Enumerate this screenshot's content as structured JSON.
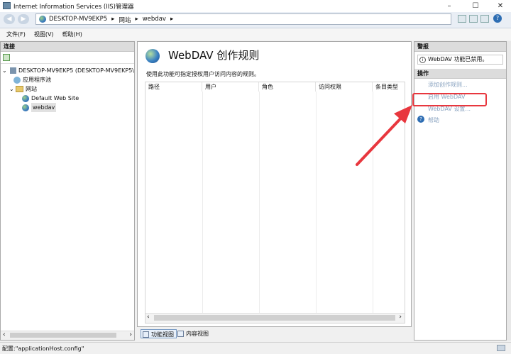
{
  "window": {
    "title": "Internet Information Services (IIS)管理器",
    "minimize_glyph": "–",
    "maximize_glyph": "☐",
    "close_glyph": "✕"
  },
  "address": {
    "back_glyph": "◀",
    "forward_glyph": "▶",
    "crumbs": [
      "DESKTOP-MV9EKP5",
      "▸",
      "网站",
      "▸",
      "webdav",
      "▸"
    ],
    "help_glyph": "?"
  },
  "menu": {
    "file": "文件(F)",
    "view": "视图(V)",
    "help": "帮助(H)"
  },
  "connections": {
    "header": "连接",
    "tree": {
      "server": "DESKTOP-MV9EKP5 (DESKTOP-MV9EKP5\\",
      "app_pools": "应用程序池",
      "sites": "网站",
      "default_site": "Default Web Site",
      "webdav_site": "webdav"
    },
    "expand_open": "⌄"
  },
  "feature": {
    "title": "WebDAV 创作规则",
    "description": "使用此功能可指定授权用户访问内容的规则。",
    "columns": [
      "路径",
      "用户",
      "角色",
      "访问权限",
      "条目类型"
    ],
    "scroll_left": "‹",
    "scroll_right": "›"
  },
  "view_tabs": {
    "features": "功能视图",
    "content": "内容视图"
  },
  "actions_pane": {
    "alerts_header": "警报",
    "alert_text": "WebDAV 功能已禁用。",
    "actions_header": "操作",
    "add_rule": "添加创作规则...",
    "enable_webdav": "启用 WebDAV",
    "webdav_settings": "WebDAV 设置...",
    "help": "帮助"
  },
  "status": {
    "text": "配置:\"applicationHost.config\""
  },
  "colors": {
    "annotation_red": "#e8373e",
    "link_blue": "#8aa3c0"
  }
}
